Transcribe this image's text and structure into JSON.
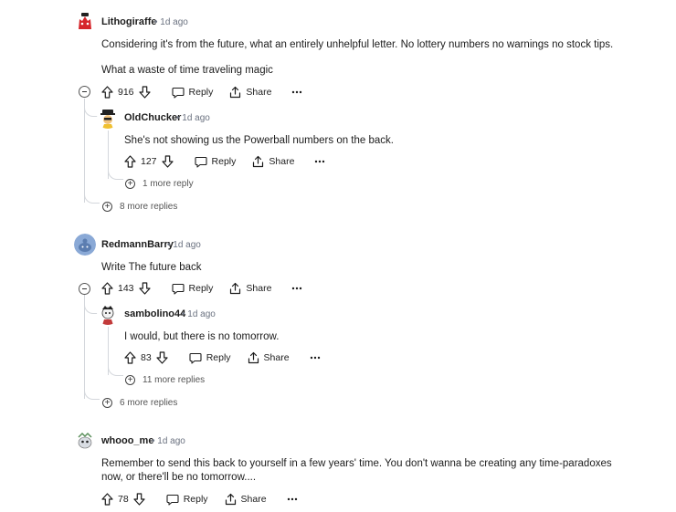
{
  "comments": [
    {
      "username": "Lithogiraffe",
      "time": "1d ago",
      "body": [
        "Considering it's from the future, what an entirely unhelpful letter. No lottery numbers no warnings no stock tips.",
        "What a waste of time traveling magic"
      ],
      "votes": "916",
      "reply_label": "Reply",
      "share_label": "Share",
      "more_replies": "8 more replies",
      "reply": {
        "username": "OldChucker",
        "time": "1d ago",
        "body": "She's not showing us the Powerball numbers on the back.",
        "votes": "127",
        "reply_label": "Reply",
        "share_label": "Share",
        "more_replies": "1 more reply"
      }
    },
    {
      "username": "RedmannBarry",
      "time": "1d ago",
      "body": [
        "Write The future back"
      ],
      "votes": "143",
      "reply_label": "Reply",
      "share_label": "Share",
      "more_replies": "6 more replies",
      "reply": {
        "username": "sambolino44",
        "time": "1d ago",
        "body": "I would, but there is no tomorrow.",
        "votes": "83",
        "reply_label": "Reply",
        "share_label": "Share",
        "more_replies": "11 more replies"
      }
    },
    {
      "username": "whooo_me",
      "time": "1d ago",
      "body": [
        "Remember to send this back to yourself in a few years' time. You don't wanna be creating any time-paradoxes",
        "now, or there'll be no tomorrow...."
      ],
      "votes": "78",
      "reply_label": "Reply",
      "share_label": "Share"
    }
  ],
  "icons": {
    "upvote": "upvote-icon",
    "downvote": "downvote-icon",
    "reply": "speech-bubble-icon",
    "share": "share-icon",
    "overflow": "ellipsis-icon",
    "collapse": "minus-circle-icon",
    "expand": "plus-circle-icon"
  },
  "colors": {
    "text": "#1c1c1c",
    "meta": "#6b7280",
    "thread_line": "#d4d7dc"
  }
}
